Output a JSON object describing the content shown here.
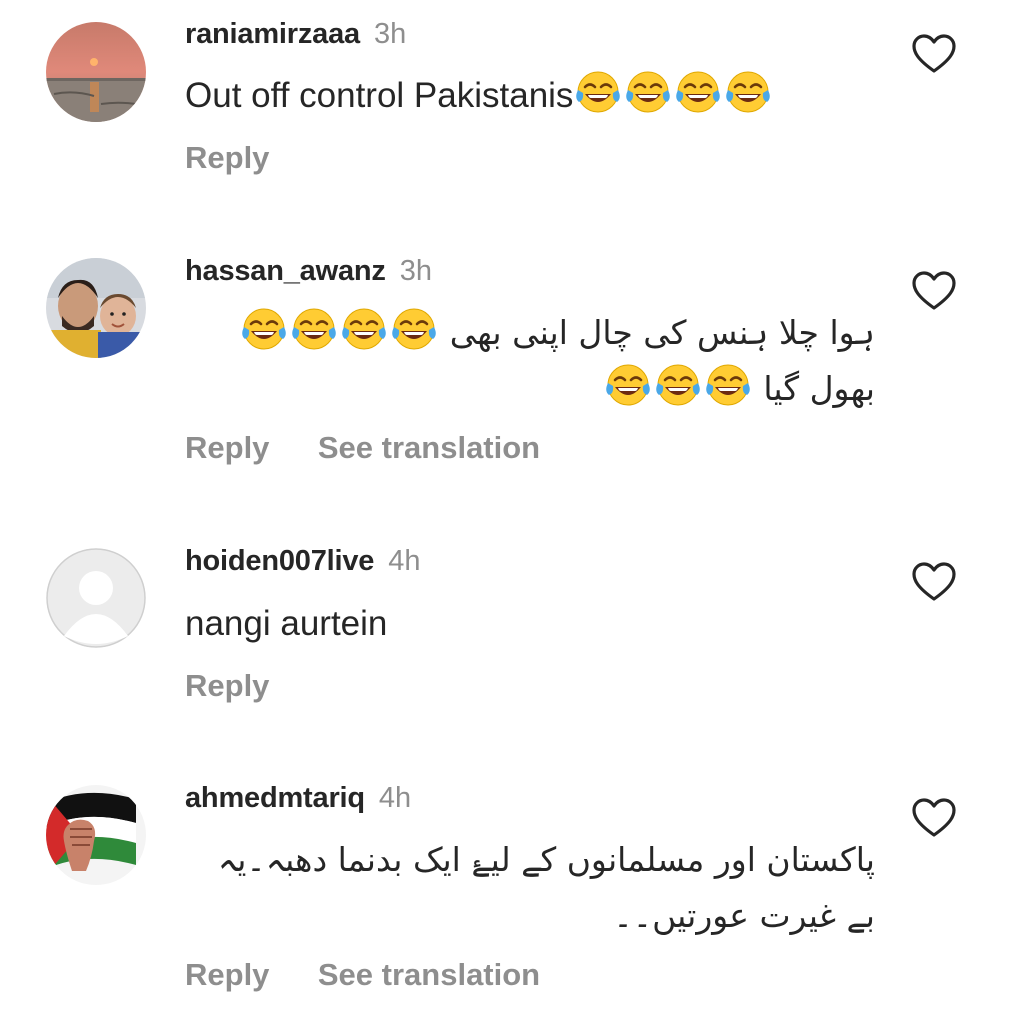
{
  "comments": [
    {
      "username": "raniamirzaaa",
      "time": "3h",
      "text": "Out off control Pakistanis",
      "emoji_count": 4,
      "reply_label": "Reply",
      "avatar": "sunset-avatar",
      "heart_icon": "heart-outline-icon"
    },
    {
      "username": "hassan_awanz",
      "time": "3h",
      "text_line1": "ہوا چلا ہنس کی چال اپنی بھی",
      "text_line2": "بھول گیا",
      "emoji_count_line1": 4,
      "emoji_count_line2": 3,
      "reply_label": "Reply",
      "translate_label": "See translation",
      "avatar": "man-with-child-avatar",
      "heart_icon": "heart-outline-icon"
    },
    {
      "username": "hoiden007live",
      "time": "4h",
      "text": "nangi aurtein",
      "reply_label": "Reply",
      "avatar": "default-user-avatar",
      "heart_icon": "heart-outline-icon"
    },
    {
      "username": "ahmedmtariq",
      "time": "4h",
      "text_line1": "پاکستان اور مسلمانوں کے لیۓ ایک بدنما دھبہ۔یہ",
      "text_line2": "بے غیرت عورتیں۔۔",
      "reply_label": "Reply",
      "translate_label": "See translation",
      "avatar": "palestine-flag-fist-avatar",
      "heart_icon": "heart-outline-icon"
    }
  ],
  "colors": {
    "text": "#262626",
    "muted": "#8e8e8e",
    "heart_outline": "#262626",
    "emoji_face": "#ffcc33",
    "emoji_tear": "#4aa8e8"
  }
}
